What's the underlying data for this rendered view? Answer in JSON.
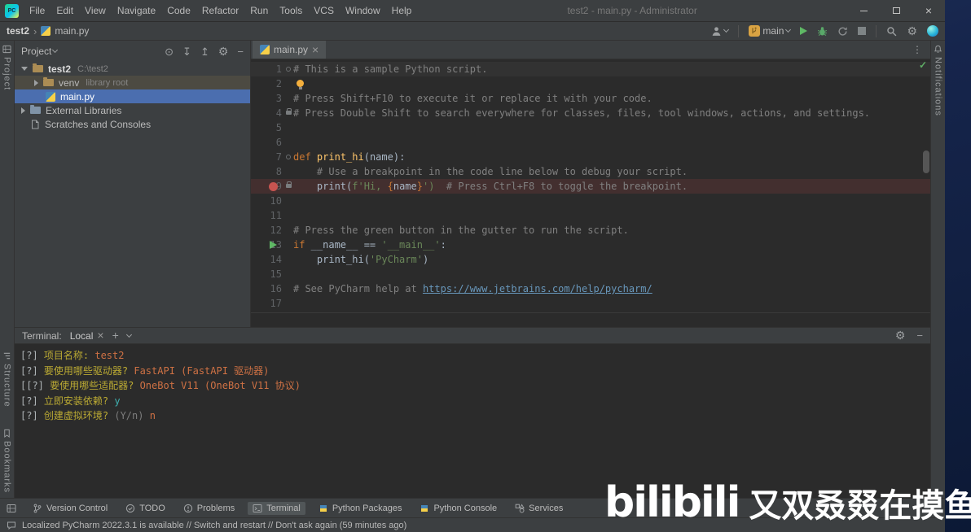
{
  "colors": {
    "panel_bg": "#3c3f41",
    "editor_bg": "#2b2b2b",
    "desktop_blue": "#16254c",
    "selection_blue": "#4b6eaf",
    "breakpoint_red": "#c75450",
    "breakpoint_line_bg": "#432f2f",
    "caret_line_bg": "#323232",
    "run_green": "#5fb865",
    "branch_badge_orange": "#d9a343",
    "comment_gray": "#808080",
    "keyword_orange": "#cc7832",
    "string_green": "#6a8759",
    "function_yellow": "#ffc66b",
    "link_blue": "#6897bb",
    "terminal_question_yellow": "#bbaa33",
    "terminal_answer_orange": "#ce7144",
    "terminal_confirm_cyan": "#3fb0b0"
  },
  "titlebar": {
    "title": "test2 - main.py - Administrator",
    "menus": [
      "File",
      "Edit",
      "View",
      "Navigate",
      "Code",
      "Refactor",
      "Run",
      "Tools",
      "VCS",
      "Window",
      "Help"
    ]
  },
  "navbar": {
    "breadcrumb_project": "test2",
    "breadcrumb_file": "main.py",
    "git_branch": "main"
  },
  "stripes": {
    "left_top": "Project",
    "left_bottom": [
      "Structure",
      "Bookmarks"
    ],
    "right_top": "Notifications"
  },
  "project_panel": {
    "title": "Project",
    "tree": [
      {
        "pad": 8,
        "arrow": "expanded",
        "icon": "folder",
        "name": "test2",
        "hint": "C:\\test2",
        "bold": true
      },
      {
        "pad": 24,
        "arrow": "collapsed",
        "icon": "folder",
        "name": "venv",
        "hint": "library root",
        "state": "hov"
      },
      {
        "pad": 38,
        "arrow": "none",
        "icon": "python-file",
        "name": "main.py",
        "state": "sel"
      },
      {
        "pad": 8,
        "arrow": "collapsed",
        "icon": "libraries",
        "name": "External Libraries"
      },
      {
        "pad": 8,
        "arrow": "spacer",
        "icon": "scratches",
        "name": "Scratches and Consoles"
      }
    ]
  },
  "editor": {
    "tab": "main.py",
    "lines": [
      {
        "n": 1,
        "bg": "caret",
        "marks": [
          "fold"
        ],
        "code": [
          [
            "cm",
            "# This is a sample Python script."
          ]
        ]
      },
      {
        "n": 2,
        "bulb": true,
        "code": []
      },
      {
        "n": 3,
        "code": [
          [
            "cm",
            "# Press Shift+F10 to execute it or replace it with your code."
          ]
        ]
      },
      {
        "n": 4,
        "marks": [
          "lock"
        ],
        "code": [
          [
            "cm",
            "# Press Double Shift to search everywhere for classes, files, tool windows, actions, and settings."
          ]
        ]
      },
      {
        "n": 5,
        "code": []
      },
      {
        "n": 6,
        "code": []
      },
      {
        "n": 7,
        "marks": [
          "fold"
        ],
        "code": [
          [
            "kw",
            "def"
          ],
          [
            "pl",
            " "
          ],
          [
            "fn",
            "print_hi"
          ],
          [
            "pl",
            "(name):"
          ]
        ]
      },
      {
        "n": 8,
        "code": [
          [
            "pl",
            "    "
          ],
          [
            "cm",
            "# Use a breakpoint in the code line below to debug your script."
          ]
        ]
      },
      {
        "n": 9,
        "bg": "bp",
        "marks": [
          "breakpoint",
          "lock"
        ],
        "code": [
          [
            "pl",
            "    print("
          ],
          [
            "st",
            "f'Hi, "
          ],
          [
            "br",
            "{"
          ],
          [
            "pl",
            "name"
          ],
          [
            "br",
            "}"
          ],
          [
            "st",
            "')"
          ],
          [
            "pl",
            "  "
          ],
          [
            "cm",
            "# Press Ctrl+F8 to toggle the breakpoint."
          ]
        ]
      },
      {
        "n": 10,
        "code": []
      },
      {
        "n": 11,
        "code": []
      },
      {
        "n": 12,
        "code": [
          [
            "cm",
            "# Press the green button in the gutter to run the script."
          ]
        ]
      },
      {
        "n": 13,
        "marks": [
          "run"
        ],
        "code": [
          [
            "kw",
            "if"
          ],
          [
            "pl",
            " __name__ == "
          ],
          [
            "st",
            "'__main__'"
          ],
          [
            "pl",
            ":"
          ]
        ]
      },
      {
        "n": 14,
        "code": [
          [
            "pl",
            "    print_hi("
          ],
          [
            "st",
            "'PyCharm'"
          ],
          [
            "pl",
            ")"
          ]
        ]
      },
      {
        "n": 15,
        "code": []
      },
      {
        "n": 16,
        "code": [
          [
            "cm",
            "# See PyCharm help at "
          ],
          [
            "lk",
            "https://www.jetbrains.com/help/pycharm/"
          ]
        ]
      },
      {
        "n": 17,
        "code": []
      }
    ]
  },
  "terminal": {
    "label": "Terminal:",
    "tab": "Local",
    "lines": [
      [
        [
          "p",
          "[?] "
        ],
        [
          "q",
          "项目名称: "
        ],
        [
          "a",
          "test2"
        ]
      ],
      [
        [
          "p",
          "[?] "
        ],
        [
          "q",
          "要使用哪些驱动器? "
        ],
        [
          "a",
          "FastAPI (FastAPI 驱动器)"
        ]
      ],
      [
        [
          "p",
          "[[?] "
        ],
        [
          "q",
          "要使用哪些适配器? "
        ],
        [
          "a",
          "OneBot V11 (OneBot V11 协议)"
        ]
      ],
      [
        [
          "p",
          "[?] "
        ],
        [
          "q",
          "立即安装依赖? "
        ],
        [
          "y",
          "y"
        ]
      ],
      [
        [
          "p",
          "[?] "
        ],
        [
          "q",
          "创建虚拟环境? "
        ],
        [
          "d",
          "(Y/n) "
        ],
        [
          "a",
          "n"
        ]
      ]
    ]
  },
  "tool_buttons": [
    {
      "label": "Version Control",
      "icon": "vc"
    },
    {
      "label": "TODO",
      "icon": "todo"
    },
    {
      "label": "Problems",
      "icon": "problems"
    },
    {
      "label": "Terminal",
      "icon": "terminal",
      "active": true
    },
    {
      "label": "Python Packages",
      "icon": "python"
    },
    {
      "label": "Python Console",
      "icon": "python"
    },
    {
      "label": "Services",
      "icon": "services"
    }
  ],
  "statusbar": {
    "message": "Localized PyCharm 2022.3.1 is available // Switch and restart // Don't ask again (59 minutes ago)"
  },
  "watermark": {
    "logo": "bilibili",
    "text": "又双叒叕在摸鱼的N"
  }
}
